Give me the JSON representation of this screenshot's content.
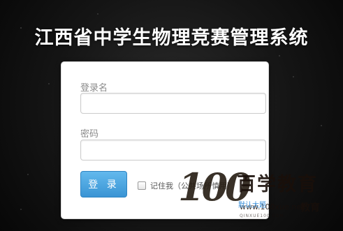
{
  "header": {
    "title": "江西省中学生物理竞赛管理系统"
  },
  "login_form": {
    "username_label": "登录名",
    "username_value": "",
    "password_label": "密码",
    "password_value": "",
    "submit_label": "登 录",
    "remember_label": "记住我（公共场所慎用）",
    "remember_checked": false,
    "default_link": "默认大题"
  },
  "watermark": {
    "logo_number": "100",
    "logo_name": "百学教育",
    "url": "www.100xue.net",
    "tagline": "教育",
    "small_text": "QINXUE100.COM"
  },
  "colors": {
    "button_top": "#63b9ed",
    "button_bottom": "#3a94d4",
    "link": "#3a8fd9",
    "background": "#151515"
  }
}
